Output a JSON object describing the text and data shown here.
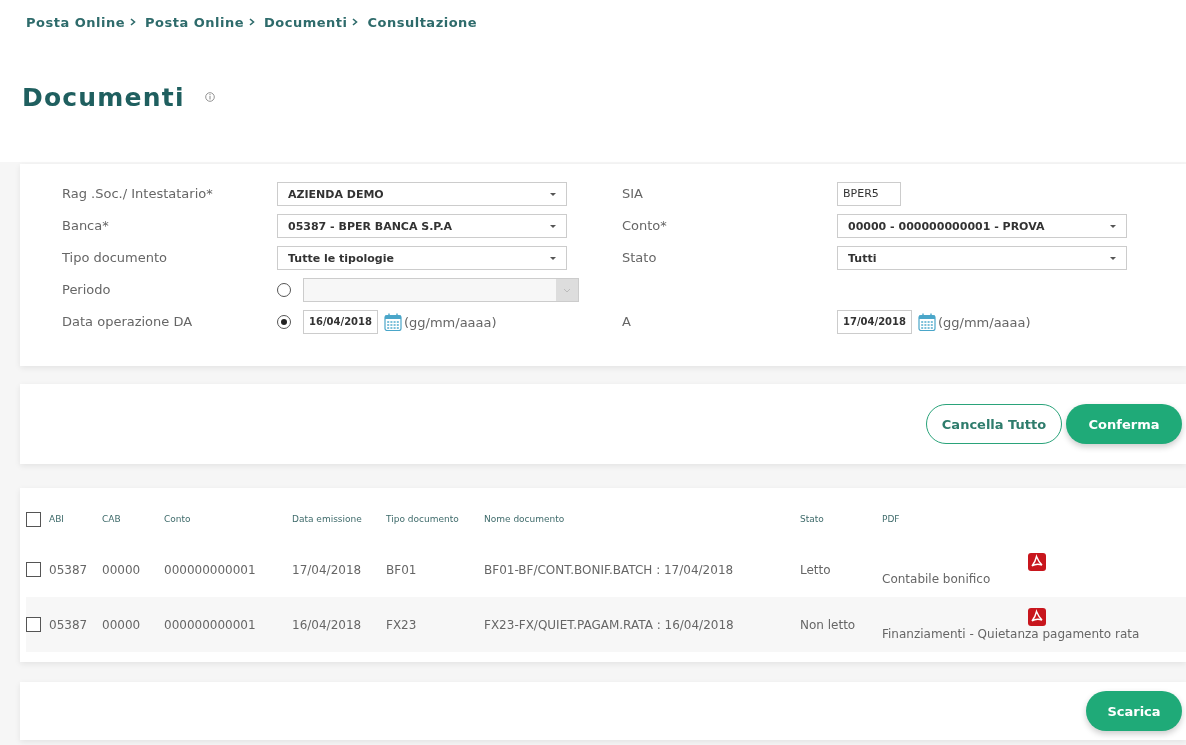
{
  "breadcrumb": [
    "Posta Online",
    "Posta Online",
    "Documenti",
    "Consultazione"
  ],
  "title": "Documenti",
  "form": {
    "rows": [
      {
        "left": {
          "label": "Rag .Soc./ Intestatario*",
          "kind": "select",
          "value": "AZIENDA DEMO"
        },
        "right": {
          "label": "SIA",
          "kind": "text",
          "value": "BPER5"
        }
      },
      {
        "left": {
          "label": "Banca*",
          "kind": "select",
          "value": "05387 - BPER BANCA S.P.A"
        },
        "right": {
          "label": "Conto*",
          "kind": "select",
          "value": "00000 - 000000000001 - PROVA"
        }
      },
      {
        "left": {
          "label": "Tipo documento",
          "kind": "select",
          "value": "Tutte le tipologie"
        },
        "right": {
          "label": "Stato",
          "kind": "select",
          "value": "Tutti"
        }
      },
      {
        "left": {
          "label": "Periodo",
          "kind": "period",
          "selected": false,
          "disabled": true
        }
      },
      {
        "left": {
          "label": "Data operazione DA",
          "kind": "date",
          "selected": true,
          "value": "16/04/2018",
          "hint": "(gg/mm/aaaa)"
        },
        "right": {
          "label": "A",
          "kind": "date",
          "value": "17/04/2018",
          "hint": "(gg/mm/aaaa)"
        }
      }
    ]
  },
  "actions": [
    {
      "label": "Cancella Tutto",
      "kind": "outline"
    },
    {
      "label": "Conferma",
      "kind": "primary"
    }
  ],
  "table": {
    "select_all": {
      "checked": false
    },
    "columns": [
      "ABI",
      "CAB",
      "Conto",
      "Data emissione",
      "Tipo documento",
      "Nome documento",
      "Stato",
      "PDF"
    ],
    "rows": [
      {
        "checked": false,
        "cells": [
          "05387",
          "00000",
          "000000000001",
          "17/04/2018",
          "BF01",
          "BF01-BF/CONT.BONIF.BATCH : 17/04/2018",
          "Letto"
        ],
        "pdf": "Contabile bonifico"
      },
      {
        "checked": false,
        "cells": [
          "05387",
          "00000",
          "000000000001",
          "16/04/2018",
          "FX23",
          "FX23-FX/QUIET.PAGAM.RATA : 16/04/2018",
          "Non letto"
        ],
        "pdf": "Finanziamenti - Quietanza pagamento rata"
      }
    ]
  },
  "download": {
    "label": "Scarica"
  }
}
